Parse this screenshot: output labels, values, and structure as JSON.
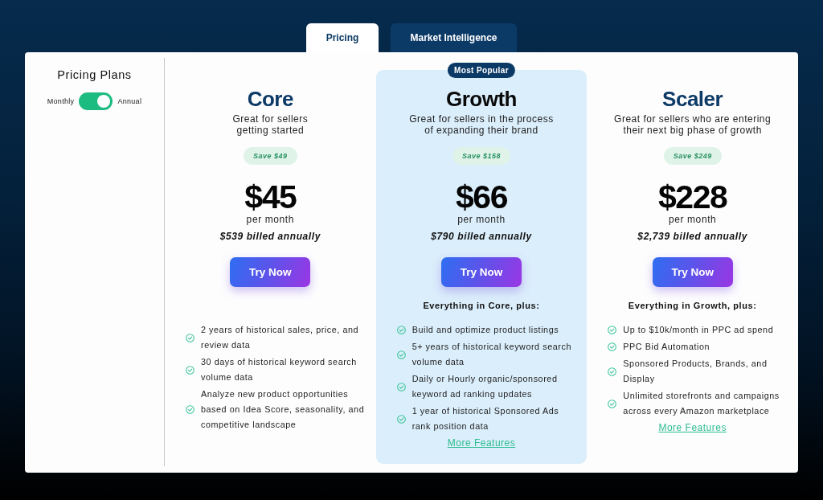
{
  "tabs": [
    {
      "label": "Pricing",
      "selected": true
    },
    {
      "label": "Market Intelligence",
      "selected": false
    }
  ],
  "sidebar": {
    "title": "Pricing Plans",
    "billing_toggle": {
      "left_label": "Monthly",
      "right_label": "Annual",
      "on": true
    }
  },
  "plans": [
    {
      "name": "Core",
      "featured": false,
      "tagline": "Great for sellers\ngetting started",
      "savings": "Save $49",
      "price": "$45",
      "period": "per month",
      "billed": "$539 billed annually",
      "button": "Try Now",
      "features": [
        "2 years of historical sales, price, and review data",
        "30 days of historical keyword search volume data",
        "Analyze new product opportunities based on Idea Score, seasonality, and competitive landscape"
      ]
    },
    {
      "name": "Growth",
      "featured": true,
      "badge": "Most Popular",
      "tagline": "Great for sellers in the process\nof expanding their brand",
      "savings": "Save $158",
      "price": "$66",
      "period": "per month",
      "billed": "$790 billed annually",
      "button": "Try Now",
      "features_heading": "Everything in Core, plus:",
      "features": [
        "Build and optimize product listings",
        "5+ years of historical keyword search volume data",
        "Daily or Hourly organic/sponsored keyword ad ranking updates",
        "1 year of historical Sponsored Ads rank position data"
      ],
      "more_link": "More Features"
    },
    {
      "name": "Scaler",
      "featured": false,
      "tagline": "Great for sellers who are entering\ntheir next big phase of growth",
      "savings": "Save $249",
      "price": "$228",
      "period": "per month",
      "billed": "$2,739 billed annually",
      "button": "Try Now",
      "features_heading": "Everything in Growth, plus:",
      "features": [
        "Up to $10k/month in PPC ad spend",
        "PPC Bid Automation",
        "Sponsored Products, Brands, and Display",
        "Unlimited storefronts and campaigns across every Amazon marketplace"
      ],
      "more_link": "More Features"
    }
  ]
}
